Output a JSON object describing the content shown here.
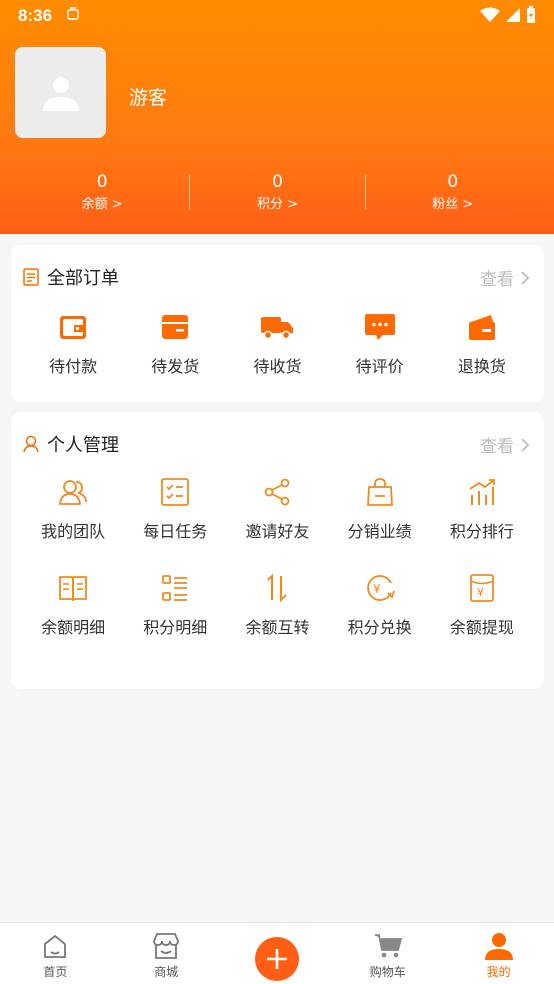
{
  "status_bar": {
    "time": "8:36"
  },
  "profile": {
    "username": "游客"
  },
  "stats": [
    {
      "value": "0",
      "label": "余额 >"
    },
    {
      "value": "0",
      "label": "积分 >"
    },
    {
      "value": "0",
      "label": "粉丝 >"
    }
  ],
  "orders": {
    "title": "全部订单",
    "more": "查看",
    "items": [
      {
        "label": "待付款",
        "icon": "wallet-icon"
      },
      {
        "label": "待发货",
        "icon": "box-icon"
      },
      {
        "label": "待收货",
        "icon": "truck-icon"
      },
      {
        "label": "待评价",
        "icon": "comment-icon"
      },
      {
        "label": "退换货",
        "icon": "return-icon"
      }
    ]
  },
  "personal": {
    "title": "个人管理",
    "more": "查看",
    "row1": [
      {
        "label": "我的团队",
        "icon": "team-icon"
      },
      {
        "label": "每日任务",
        "icon": "checklist-icon"
      },
      {
        "label": "邀请好友",
        "icon": "share-icon"
      },
      {
        "label": "分销业绩",
        "icon": "bag-icon"
      },
      {
        "label": "积分排行",
        "icon": "ranking-icon"
      }
    ],
    "row2": [
      {
        "label": "余额明细",
        "icon": "book-icon"
      },
      {
        "label": "积分明细",
        "icon": "list-icon"
      },
      {
        "label": "余额互转",
        "icon": "transfer-icon"
      },
      {
        "label": "积分兑换",
        "icon": "exchange-icon"
      },
      {
        "label": "余额提现",
        "icon": "withdraw-icon"
      }
    ]
  },
  "bottom_nav": [
    {
      "label": "首页",
      "icon": "home-icon"
    },
    {
      "label": "商城",
      "icon": "store-icon"
    },
    {
      "label": "",
      "icon": "plus-icon"
    },
    {
      "label": "购物车",
      "icon": "cart-icon"
    },
    {
      "label": "我的",
      "icon": "user-icon",
      "active": true
    }
  ],
  "colors": {
    "accent": "#ff6a00",
    "header_start": "#ff8c00",
    "header_end": "#ff5f17"
  }
}
